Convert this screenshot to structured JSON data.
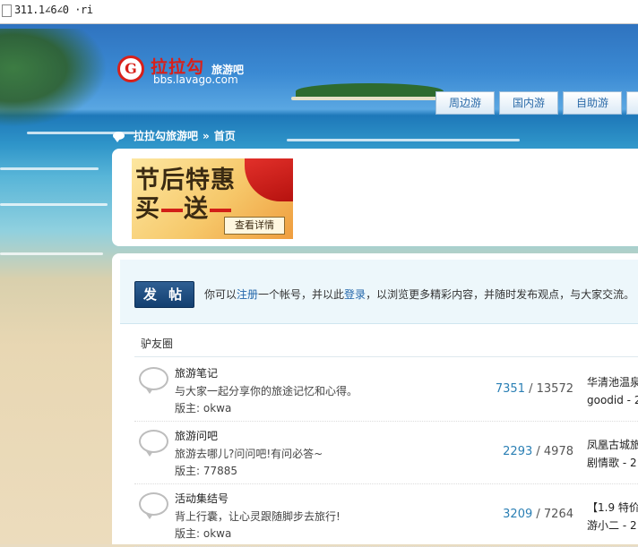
{
  "browser": {
    "url_text": "311.1∠6∠0 ·ri"
  },
  "site": {
    "logo_mark": "G",
    "logo_name": "拉拉勾",
    "logo_sub": "旅游吧",
    "domain": "bbs.lavago.com"
  },
  "nav": {
    "tabs": [
      "周边游",
      "国内游",
      "自助游"
    ]
  },
  "breadcrumb": {
    "forum": "拉拉勾旅游吧",
    "separator": "»",
    "current": "首页"
  },
  "ad": {
    "line1": "节后特惠",
    "line2_a": "买",
    "line2_b": "送",
    "button": "查看详情"
  },
  "welcome": {
    "post_button": "发 帖",
    "text_before": "你可以",
    "register_link": "注册",
    "text_middle": "一个帐号，并以此",
    "login_link": "登录",
    "text_after": "，以浏览更多精彩内容，并随时发布观点，与大家交流。"
  },
  "section": {
    "title": "驴友圈"
  },
  "forums": [
    {
      "name": "旅游笔记",
      "desc": "与大家一起分享你的旅途记忆和心得。",
      "moderator": "版主: okwa",
      "threads": "7351",
      "posts": "13572",
      "last_title": "华清池温泉",
      "last_user": "goodid - 2"
    },
    {
      "name": "旅游问吧",
      "desc": "旅游去哪儿?问问吧!有问必答~",
      "moderator": "版主: 77885",
      "threads": "2293",
      "posts": "4978",
      "last_title": "凤凰古城旅",
      "last_user": "剧情歌 - 2"
    },
    {
      "name": "活动集结号",
      "desc": "背上行囊，让心灵跟随脚步去旅行!",
      "moderator": "版主: okwa",
      "threads": "3209",
      "posts": "7264",
      "last_title": "【1.9 特价",
      "last_user": "游小二 - 2"
    }
  ]
}
